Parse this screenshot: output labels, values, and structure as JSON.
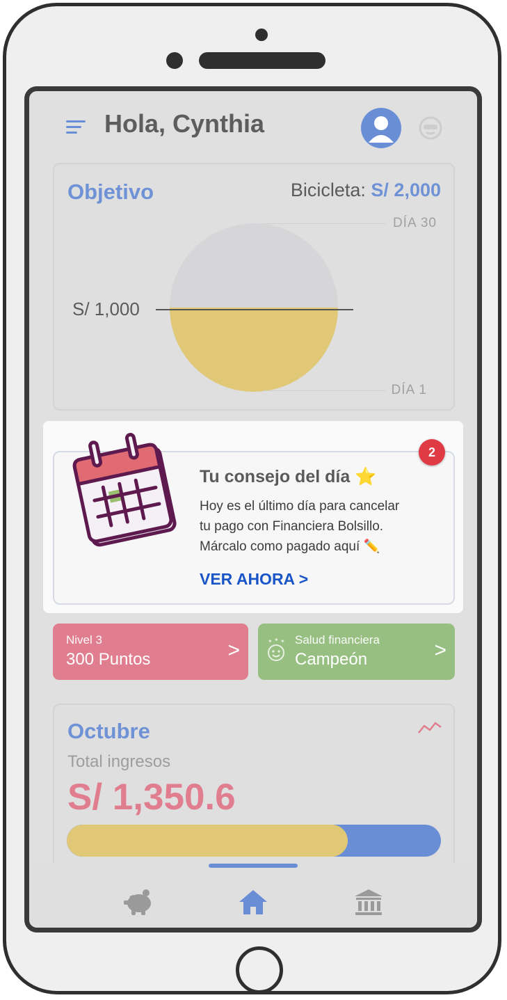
{
  "header": {
    "greeting": "Hola, Cynthia"
  },
  "objetivo": {
    "title": "Objetivo",
    "goal_name": "Bicicleta: ",
    "goal_amount": "S/ 2,000",
    "top_label": "DÍA 30",
    "bottom_label": "DÍA 1",
    "current_label": "S/ 1,000",
    "progress_fraction": 0.5
  },
  "tip": {
    "badge": "2",
    "title": "Tu consejo del día ⭐",
    "line1": "Hoy es el último día para cancelar",
    "line2": "tu pago con Financiera Bolsillo.",
    "line3": "Márcalo como pagado aquí ✏️",
    "link": "VER AHORA >"
  },
  "level_tile": {
    "small": "Nivel 3",
    "big": "300 Puntos",
    "chevron": ">"
  },
  "health_tile": {
    "small": "Salud financiera",
    "big": "Campeón",
    "chevron": ">"
  },
  "october": {
    "title": "Octubre",
    "subtitle": "Total ingresos",
    "amount": "S/ 1,350.6",
    "bar_fraction": 0.75
  },
  "nav": {
    "items": [
      "piggy-bank-icon",
      "home-icon",
      "bank-icon"
    ],
    "active": "home-icon"
  },
  "colors": {
    "accent_blue": "#6a8ed6",
    "yellow": "#e0c877",
    "pink": "#e07e8f",
    "green": "#98bf82",
    "link_blue": "#1a55c7",
    "badge_red": "#e03a44"
  }
}
